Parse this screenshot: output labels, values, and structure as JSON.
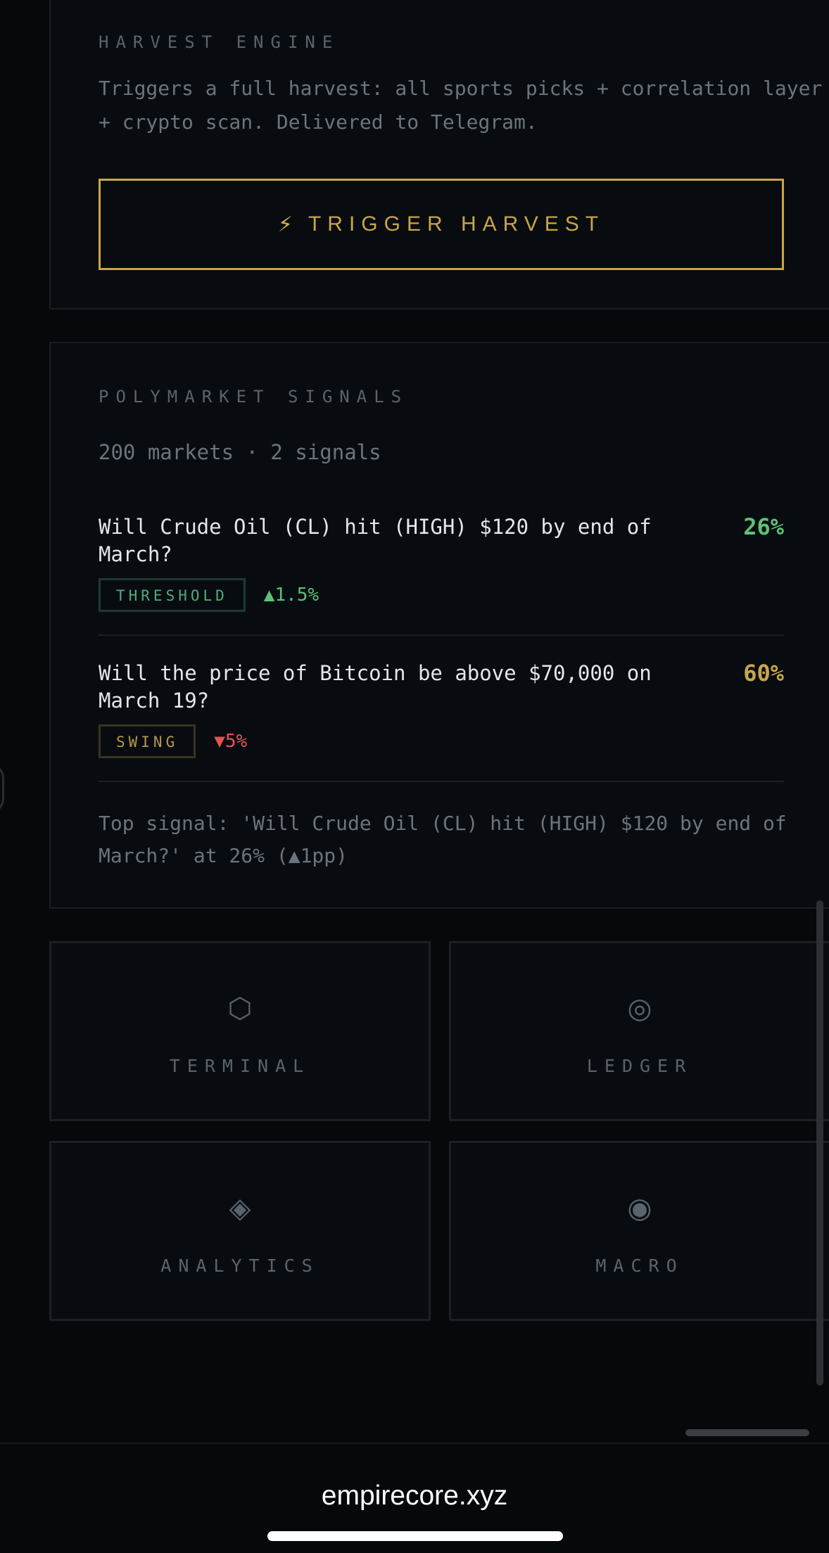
{
  "harvest": {
    "label": "HARVEST ENGINE",
    "description": "Triggers a full harvest: all sports picks + correlation layer + crypto scan. Delivered to Telegram.",
    "button_icon": "⚡",
    "button_label": "TRIGGER HARVEST"
  },
  "polymarket": {
    "label": "POLYMARKET SIGNALS",
    "meta": "200 markets · 2 signals",
    "signals": [
      {
        "question": "Will Crude Oil (CL) hit (HIGH) $120 by end of March?",
        "percent": "26%",
        "tag": "THRESHOLD",
        "delta": "▲1.5%"
      },
      {
        "question": "Will the price of Bitcoin be above $70,000 on March 19?",
        "percent": "60%",
        "tag": "SWING",
        "delta": "▼5%"
      }
    ],
    "footnote": "Top signal: 'Will Crude Oil (CL) hit (HIGH) $120 by end of March?' at 26% (▲1pp)"
  },
  "nav_tiles": [
    {
      "icon": "⬡",
      "label": "TERMINAL"
    },
    {
      "icon": "◎",
      "label": "LEDGER"
    },
    {
      "icon": "◈",
      "label": "ANALYTICS"
    },
    {
      "icon": "◉",
      "label": "MACRO"
    }
  ],
  "browser": {
    "url": "empirecore.xyz"
  },
  "colors": {
    "gold": "#c8a548",
    "green": "#5dc177",
    "red": "#e0554f",
    "background": "#05090c"
  }
}
